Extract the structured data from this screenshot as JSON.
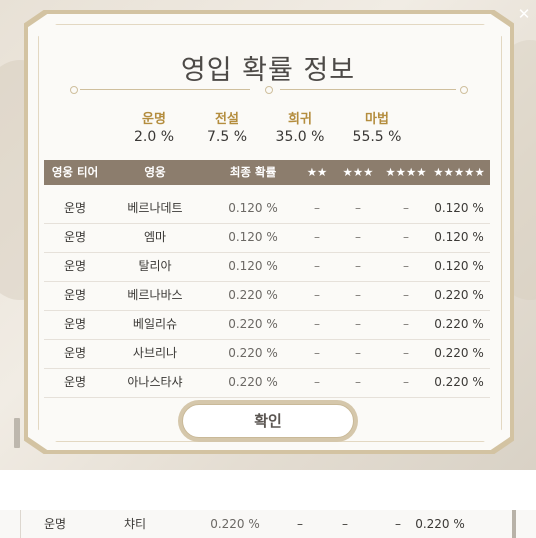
{
  "dialog": {
    "title": "영입 확률 정보",
    "confirm_label": "확인",
    "close_icon": "close-icon"
  },
  "summary": [
    {
      "label": "운명",
      "value": "2.0 %"
    },
    {
      "label": "전설",
      "value": "7.5 %"
    },
    {
      "label": "희귀",
      "value": "35.0 %"
    },
    {
      "label": "마법",
      "value": "55.5 %"
    }
  ],
  "table": {
    "headers": [
      "영웅 티어",
      "영웅",
      "최종 확률",
      "★★",
      "★★★",
      "★★★★",
      "★★★★★"
    ],
    "rows": [
      [
        "운명",
        "베르나데트",
        "0.120 %",
        "–",
        "–",
        "–",
        "0.120 %"
      ],
      [
        "운명",
        "엠마",
        "0.120 %",
        "–",
        "–",
        "–",
        "0.120 %"
      ],
      [
        "운명",
        "탈리아",
        "0.120 %",
        "–",
        "–",
        "–",
        "0.120 %"
      ],
      [
        "운명",
        "베르나바스",
        "0.220 %",
        "–",
        "–",
        "–",
        "0.220 %"
      ],
      [
        "운명",
        "베일리슈",
        "0.220 %",
        "–",
        "–",
        "–",
        "0.220 %"
      ],
      [
        "운명",
        "사브리나",
        "0.220 %",
        "–",
        "–",
        "–",
        "0.220 %"
      ],
      [
        "운명",
        "아나스타샤",
        "0.220 %",
        "–",
        "–",
        "–",
        "0.220 %"
      ]
    ]
  },
  "extra_row": [
    "운명",
    "챠티",
    "0.220 %",
    "–",
    "–",
    "–",
    "0.220 %"
  ],
  "colors": {
    "accent_gold": "#b48d3e",
    "header_bg": "#8c7d6d",
    "frame": "#d3c3a2"
  }
}
